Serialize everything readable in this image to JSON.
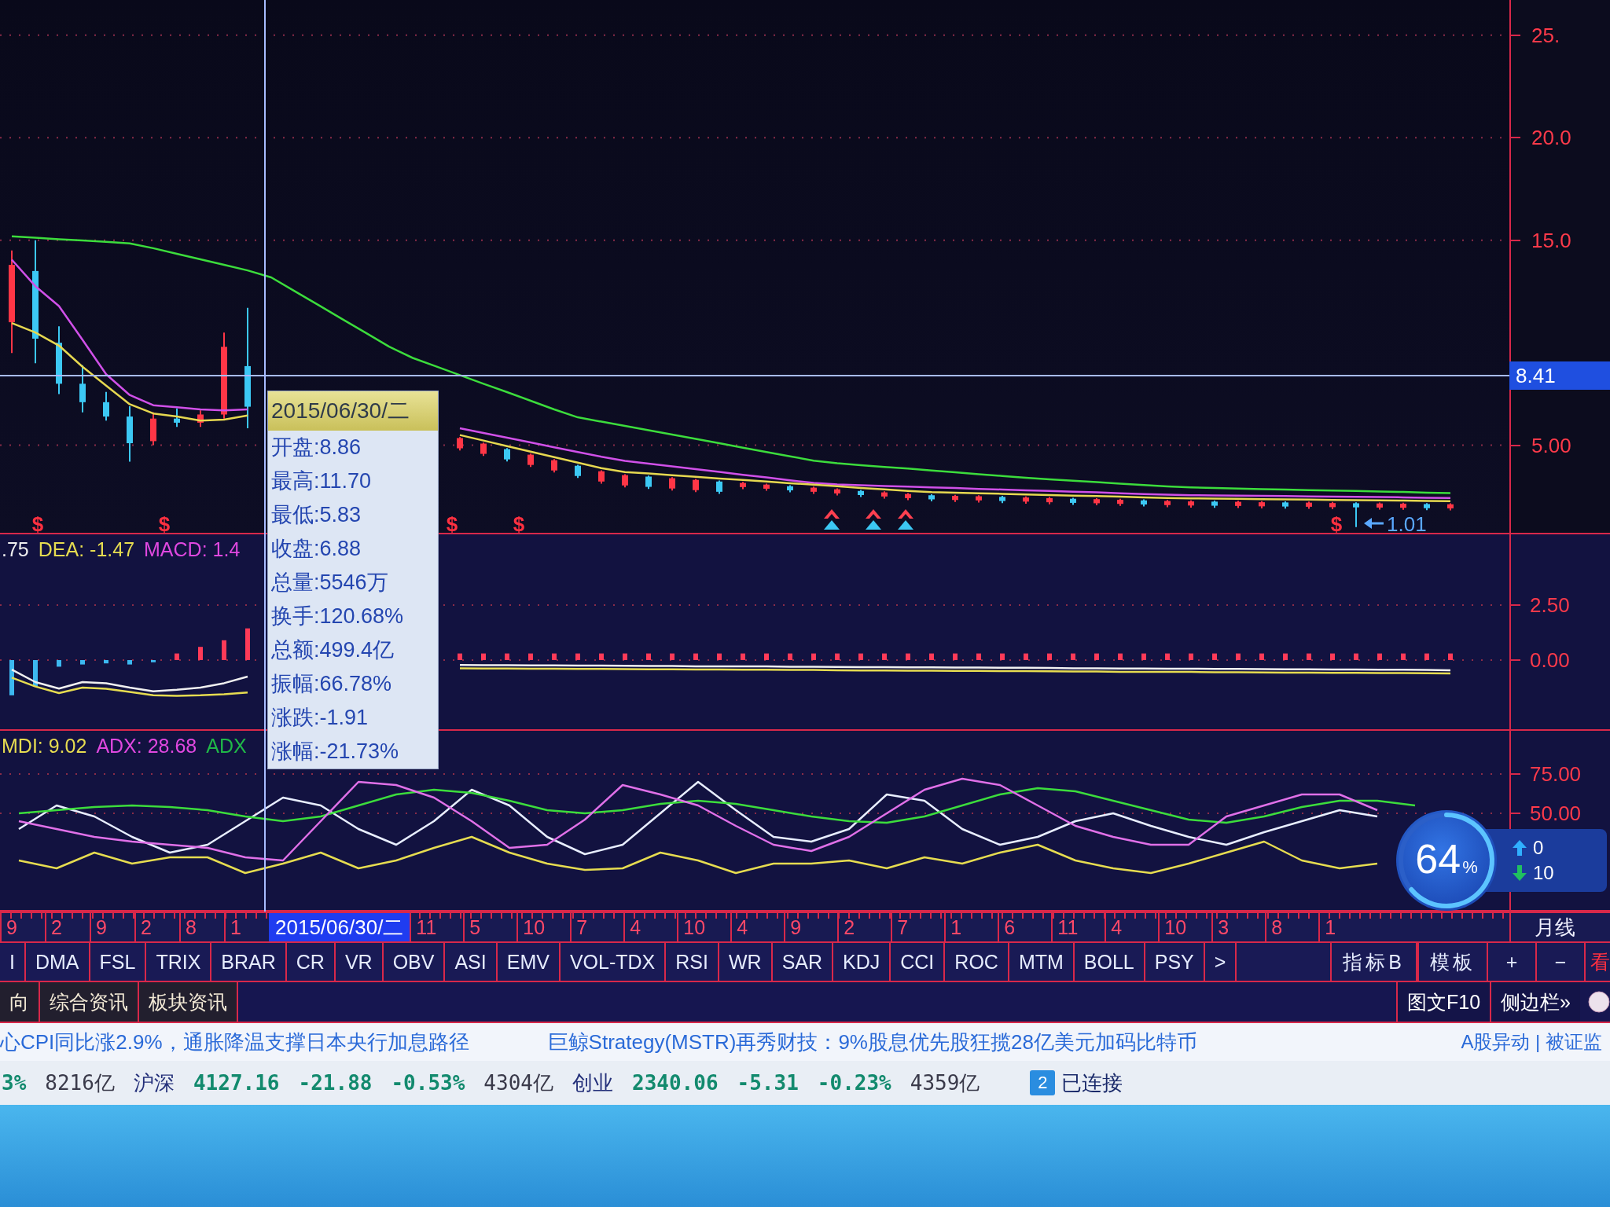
{
  "price_chart": {
    "chart_data": {
      "type": "candlestick",
      "grid": true,
      "categories": [
        null,
        null,
        null,
        null,
        null,
        null,
        null,
        null,
        null,
        null,
        null,
        null,
        null,
        null,
        null,
        null,
        null,
        null,
        null,
        null,
        null,
        null,
        null,
        null,
        null,
        null,
        null,
        null,
        null,
        null,
        null,
        null,
        null,
        null,
        null,
        null,
        null,
        null,
        null,
        null,
        null,
        null,
        null,
        null,
        null,
        null,
        null,
        null,
        null,
        null,
        null,
        null,
        null,
        null,
        null,
        null,
        null,
        null,
        null,
        null,
        null,
        null,
        null,
        null
      ],
      "ylim": [
        0.73,
        26.72
      ],
      "yticks": [
        {
          "value": 25,
          "label": "25."
        },
        {
          "value": 20,
          "label": "20.0"
        },
        {
          "value": 15,
          "label": "15.0"
        },
        {
          "value": 5,
          "label": "5.00"
        }
      ],
      "ohlc": [
        [
          11.0,
          14.5,
          9.5,
          13.8
        ],
        [
          13.5,
          15.0,
          9.0,
          10.2
        ],
        [
          10.0,
          10.8,
          7.5,
          8.0
        ],
        [
          8.0,
          8.9,
          6.6,
          7.1
        ],
        [
          7.1,
          7.6,
          6.2,
          6.4
        ],
        [
          6.4,
          6.9,
          4.2,
          5.1
        ],
        [
          5.2,
          6.6,
          5.0,
          6.3
        ],
        [
          6.3,
          6.8,
          5.9,
          6.1
        ],
        [
          6.1,
          6.7,
          5.9,
          6.5
        ],
        [
          6.5,
          10.5,
          6.3,
          9.8
        ],
        [
          8.86,
          11.7,
          5.83,
          6.88
        ],
        null,
        null,
        null,
        null,
        null,
        null,
        null,
        null,
        [
          4.85,
          5.4,
          4.75,
          5.35
        ],
        [
          4.58,
          5.13,
          4.48,
          5.08
        ],
        [
          4.81,
          4.86,
          4.21,
          4.31
        ],
        [
          4.04,
          4.59,
          3.94,
          4.54
        ],
        [
          3.77,
          4.32,
          3.67,
          4.27
        ],
        [
          4.0,
          4.05,
          3.4,
          3.5
        ],
        [
          3.23,
          3.78,
          3.13,
          3.73
        ],
        [
          3.04,
          3.59,
          2.94,
          3.54
        ],
        [
          3.47,
          3.52,
          2.87,
          2.97
        ],
        [
          2.89,
          3.44,
          2.79,
          3.39
        ],
        [
          2.81,
          3.36,
          2.71,
          3.31
        ],
        [
          3.23,
          3.28,
          2.63,
          2.73
        ],
        [
          2.96,
          3.21,
          2.86,
          3.16
        ],
        [
          2.88,
          3.13,
          2.78,
          3.08
        ],
        [
          3.0,
          3.05,
          2.7,
          2.8
        ],
        [
          2.73,
          2.98,
          2.63,
          2.93
        ],
        [
          2.65,
          2.9,
          2.55,
          2.85
        ],
        [
          2.77,
          2.82,
          2.47,
          2.57
        ],
        [
          2.5,
          2.75,
          2.4,
          2.7
        ],
        [
          2.42,
          2.67,
          2.32,
          2.62
        ],
        [
          2.56,
          2.61,
          2.26,
          2.36
        ],
        [
          2.33,
          2.58,
          2.23,
          2.53
        ],
        [
          2.31,
          2.56,
          2.21,
          2.51
        ],
        [
          2.48,
          2.53,
          2.18,
          2.28
        ],
        [
          2.25,
          2.5,
          2.15,
          2.45
        ],
        [
          2.22,
          2.47,
          2.12,
          2.42
        ],
        [
          2.39,
          2.44,
          2.09,
          2.19
        ],
        [
          2.17,
          2.42,
          2.07,
          2.37
        ],
        [
          2.14,
          2.39,
          2.04,
          2.34
        ],
        [
          2.31,
          2.36,
          2.01,
          2.11
        ],
        [
          2.08,
          2.33,
          1.98,
          2.28
        ],
        [
          2.06,
          2.31,
          1.96,
          2.26
        ],
        [
          2.25,
          2.3,
          1.95,
          2.05
        ],
        [
          2.04,
          2.29,
          1.94,
          2.24
        ],
        [
          2.02,
          2.27,
          1.92,
          2.22
        ],
        [
          2.21,
          2.26,
          1.91,
          2.01
        ],
        [
          2.0,
          2.25,
          1.9,
          2.2
        ],
        [
          1.98,
          2.23,
          1.88,
          2.18
        ],
        [
          2.17,
          2.22,
          1.01,
          1.97
        ],
        [
          1.96,
          2.21,
          1.86,
          2.16
        ],
        [
          1.95,
          2.2,
          1.85,
          2.15
        ],
        [
          2.13,
          2.18,
          1.83,
          1.93
        ],
        [
          1.92,
          2.17,
          1.82,
          2.12
        ],
        null,
        null
      ],
      "series": [
        {
          "type": "line",
          "color": "#3cdc3c",
          "values": [
            15.19,
            15.12,
            15.05,
            14.99,
            14.92,
            14.85,
            14.61,
            14.34,
            14.07,
            13.8,
            13.53,
            13.19,
            12.51,
            11.84,
            11.16,
            10.49,
            9.81,
            9.26,
            8.84,
            8.42,
            8.0,
            7.59,
            7.17,
            6.75,
            6.36,
            6.15,
            5.94,
            5.73,
            5.52,
            5.31,
            5.1,
            4.88,
            4.67,
            4.46,
            4.25,
            4.12,
            4.03,
            3.94,
            3.86,
            3.77,
            3.68,
            3.59,
            3.5,
            3.41,
            3.34,
            3.27,
            3.2,
            3.13,
            3.06,
            2.99,
            2.94,
            2.91,
            2.89,
            2.86,
            2.84,
            2.81,
            2.79,
            2.77,
            2.74,
            2.72,
            2.69,
            2.67,
            null,
            null
          ]
        },
        {
          "type": "line",
          "color": "#d050e8",
          "values": [
            14.05,
            12.76,
            11.79,
            10.14,
            8.46,
            7.45,
            6.95,
            6.85,
            6.75,
            6.7,
            6.75,
            null,
            null,
            null,
            null,
            null,
            null,
            null,
            null,
            5.83,
            5.6,
            5.37,
            5.14,
            4.9,
            4.67,
            4.44,
            4.24,
            4.1,
            3.97,
            3.83,
            3.7,
            3.56,
            3.43,
            3.29,
            3.16,
            3.09,
            3.05,
            3.01,
            2.98,
            2.94,
            2.91,
            2.87,
            2.84,
            2.8,
            2.77,
            2.73,
            2.7,
            2.66,
            2.62,
            2.59,
            2.56,
            2.55,
            2.54,
            2.53,
            2.52,
            2.5,
            2.49,
            2.48,
            2.47,
            2.46,
            2.44,
            2.43,
            null,
            null
          ]
        },
        {
          "type": "line",
          "color": "#e6d850",
          "values": [
            10.96,
            10.5,
            9.86,
            8.83,
            7.91,
            7.0,
            6.55,
            6.4,
            6.2,
            6.25,
            6.45,
            null,
            null,
            null,
            null,
            null,
            null,
            null,
            null,
            5.5,
            5.23,
            4.96,
            4.69,
            4.42,
            4.15,
            3.88,
            3.69,
            3.62,
            3.54,
            3.46,
            3.38,
            3.31,
            3.23,
            3.15,
            3.08,
            3.0,
            2.92,
            2.85,
            2.77,
            2.71,
            2.68,
            2.66,
            2.63,
            2.6,
            2.57,
            2.54,
            2.52,
            2.49,
            2.46,
            2.43,
            2.41,
            2.4,
            2.39,
            2.37,
            2.36,
            2.35,
            2.33,
            2.32,
            2.31,
            2.3,
            2.28,
            2.27,
            null,
            null
          ]
        }
      ]
    },
    "crosshair_price": "8.41",
    "low_price": "1.01",
    "signal_marks": [
      {
        "kind": "sell",
        "symbol": "$"
      },
      {
        "kind": "sell",
        "symbol": "$"
      },
      {
        "kind": "sell",
        "symbol": "$"
      },
      {
        "kind": "sell",
        "symbol": "$"
      },
      {
        "kind": "buy"
      },
      {
        "kind": "buy"
      },
      {
        "kind": "buy"
      },
      {
        "kind": "sell",
        "symbol": "$"
      }
    ]
  },
  "tooltip": {
    "date": "2015/06/30/二",
    "rows": [
      "开盘:8.86",
      "最高:11.70",
      "最低:5.83",
      "收盘:6.88",
      "总量:5546万",
      "换手:120.68%",
      "总额:499.4亿",
      "振幅:66.78%",
      "涨跌:-1.91",
      "涨幅:-21.73%"
    ]
  },
  "macd_panel": {
    "legend": [
      {
        "text": ".75",
        "color": "#f0f0f0"
      },
      {
        "text": "DEA: -1.47",
        "color": "#e6dc50"
      },
      {
        "text": "MACD: 1.4",
        "color": "#e048e0"
      }
    ],
    "chart_data": {
      "type": "line",
      "grid": true,
      "categories": [
        null,
        null,
        null,
        null,
        null,
        null,
        null,
        null,
        null,
        null,
        null,
        null,
        null,
        null,
        null,
        null,
        null,
        null,
        null,
        null,
        null,
        null,
        null,
        null,
        null,
        null,
        null,
        null,
        null,
        null,
        null,
        null,
        null,
        null,
        null,
        null,
        null,
        null,
        null,
        null,
        null,
        null,
        null,
        null,
        null,
        null,
        null,
        null,
        null,
        null,
        null,
        null,
        null,
        null,
        null,
        null,
        null,
        null,
        null,
        null,
        null,
        null,
        null,
        null
      ],
      "ylim": [
        -3.14,
        5.71
      ],
      "yticks": [
        {
          "value": 2.5,
          "label": "2.50"
        },
        {
          "value": 0,
          "label": "0.00"
        }
      ],
      "series": [
        {
          "type": "bar",
          "color": "#ff3a58",
          "values": [
            null,
            null,
            null,
            null,
            null,
            null,
            null,
            0.3,
            0.6,
            0.9,
            1.44,
            null,
            null,
            null,
            null,
            null,
            null,
            null,
            null,
            0.3,
            0.3,
            0.3,
            0.3,
            0.3,
            0.3,
            0.3,
            0.3,
            0.3,
            0.3,
            0.3,
            0.3,
            0.3,
            0.3,
            0.3,
            0.3,
            0.3,
            0.3,
            0.3,
            0.3,
            0.3,
            0.3,
            0.3,
            0.3,
            0.3,
            0.3,
            0.3,
            0.3,
            0.3,
            0.3,
            0.3,
            0.3,
            0.3,
            0.3,
            0.3,
            0.3,
            0.3,
            0.3,
            0.3,
            0.3,
            0.3,
            0.3,
            0.3,
            null,
            null
          ]
        },
        {
          "type": "bar",
          "color": "#3cb8f0",
          "values": [
            -1.6,
            -1.2,
            -0.3,
            -0.2,
            -0.15,
            -0.2,
            -0.1,
            null,
            null,
            null,
            null,
            null,
            null,
            null,
            null,
            null,
            null,
            null,
            null,
            null,
            null,
            null,
            null,
            null,
            null,
            null,
            null,
            null,
            null,
            null,
            null,
            null,
            null,
            null,
            null,
            null,
            null,
            null,
            null,
            null,
            null,
            null,
            null,
            null,
            null,
            null,
            null,
            null,
            null,
            null,
            null,
            null,
            null,
            null,
            null,
            null,
            null,
            null,
            null,
            null,
            null,
            null,
            null,
            null
          ]
        },
        {
          "color": "#f0f0f0",
          "values": [
            -0.43,
            -1.0,
            -1.29,
            -1.0,
            -1.05,
            -1.25,
            -1.42,
            -1.35,
            -1.25,
            -1.05,
            -0.75,
            null,
            null,
            null,
            null,
            null,
            null,
            null,
            null,
            -0.22,
            -0.23,
            -0.23,
            -0.24,
            -0.24,
            -0.25,
            -0.25,
            -0.26,
            -0.27,
            -0.27,
            -0.28,
            -0.28,
            -0.29,
            -0.29,
            -0.3,
            -0.3,
            -0.31,
            -0.32,
            -0.32,
            -0.33,
            -0.33,
            -0.34,
            -0.34,
            -0.35,
            -0.35,
            -0.36,
            -0.37,
            -0.37,
            -0.38,
            -0.38,
            -0.39,
            -0.39,
            -0.4,
            -0.4,
            -0.41,
            -0.42,
            -0.42,
            -0.43,
            -0.43,
            -0.44,
            -0.44,
            -0.45,
            -0.46,
            null,
            null
          ]
        },
        {
          "color": "#e6dc50",
          "values": [
            -0.8,
            -1.2,
            -1.5,
            -1.25,
            -1.3,
            -1.45,
            -1.6,
            -1.62,
            -1.6,
            -1.55,
            -1.47,
            null,
            null,
            null,
            null,
            null,
            null,
            null,
            null,
            -0.37,
            -0.38,
            -0.38,
            -0.39,
            -0.39,
            -0.4,
            -0.4,
            -0.41,
            -0.42,
            -0.42,
            -0.43,
            -0.43,
            -0.44,
            -0.44,
            -0.45,
            -0.45,
            -0.46,
            -0.47,
            -0.47,
            -0.48,
            -0.48,
            -0.49,
            -0.49,
            -0.5,
            -0.5,
            -0.51,
            -0.52,
            -0.52,
            -0.53,
            -0.53,
            -0.54,
            -0.54,
            -0.55,
            -0.55,
            -0.56,
            -0.57,
            -0.57,
            -0.58,
            -0.58,
            -0.59,
            -0.59,
            -0.6,
            -0.61,
            null,
            null
          ]
        }
      ]
    }
  },
  "dmi_panel": {
    "legend": [
      {
        "text": "MDI: 9.02",
        "color": "#e6dc50"
      },
      {
        "text": "ADX: 28.68",
        "color": "#e048e0"
      },
      {
        "text": "ADX",
        "color": "#20b848"
      }
    ],
    "chart_data": {
      "type": "line",
      "grid": true,
      "categories": [
        null,
        null,
        null,
        null,
        null,
        null,
        null,
        null,
        null,
        null,
        null,
        null,
        null,
        null,
        null,
        null,
        null,
        null,
        null,
        null,
        null,
        null,
        null,
        null,
        null,
        null,
        null,
        null,
        null,
        null,
        null,
        null,
        null,
        null,
        null,
        null,
        null,
        null,
        null,
        null
      ],
      "ylim": [
        -11.5,
        102.5
      ],
      "yticks": [
        {
          "value": 75,
          "label": "75.00"
        },
        {
          "value": 50,
          "label": "50.00"
        }
      ],
      "series": [
        {
          "color": "#e8eeff",
          "values": [
            40,
            55,
            48,
            35,
            25,
            30,
            45,
            60,
            55,
            40,
            30,
            45,
            65,
            55,
            35,
            24,
            30,
            50,
            70,
            52,
            35,
            32,
            40,
            62,
            58,
            40,
            30,
            35,
            45,
            50,
            42,
            35,
            30,
            38,
            45,
            52,
            48,
            null,
            null,
            null
          ]
        },
        {
          "color": "#3cdc3c",
          "values": [
            50,
            52,
            54,
            55,
            54,
            52,
            48,
            45,
            48,
            55,
            62,
            65,
            63,
            58,
            52,
            50,
            52,
            56,
            58,
            56,
            52,
            48,
            45,
            44,
            48,
            55,
            62,
            66,
            64,
            58,
            52,
            46,
            44,
            48,
            54,
            58,
            58,
            55,
            null,
            null
          ]
        },
        {
          "color": "#e070e8",
          "values": [
            45,
            40,
            35,
            32,
            30,
            28,
            22,
            20,
            45,
            70,
            68,
            60,
            45,
            28,
            30,
            46,
            68,
            62,
            55,
            42,
            30,
            26,
            35,
            50,
            65,
            72,
            68,
            55,
            42,
            35,
            30,
            30,
            48,
            55,
            62,
            62,
            52,
            null,
            null,
            null
          ]
        },
        {
          "color": "#e6dc50",
          "values": [
            20,
            15,
            25,
            18,
            22,
            22,
            12,
            18,
            25,
            15,
            20,
            28,
            35,
            25,
            18,
            14,
            15,
            25,
            20,
            12,
            18,
            18,
            20,
            15,
            22,
            18,
            25,
            30,
            20,
            15,
            12,
            18,
            25,
            32,
            20,
            15,
            18,
            null,
            null,
            null
          ]
        }
      ]
    }
  },
  "gauge": {
    "value": "64",
    "unit": "%",
    "upload": "0",
    "download": "10"
  },
  "date_axis": {
    "labels_before": [
      "9",
      "2",
      "9",
      "2",
      "8",
      "1"
    ],
    "cursor_date": "2015/06/30/二",
    "labels_after": [
      "11",
      "5",
      "10",
      "7",
      "4",
      "10",
      "4",
      "9",
      "2",
      "7",
      "1",
      "6",
      "11",
      "4",
      "10",
      "3",
      "8",
      "1"
    ],
    "period": "月线"
  },
  "indicator_tabs": [
    {
      "label": "I",
      "selected": false
    },
    {
      "label": "DMA",
      "selected": false
    },
    {
      "label": "FSL",
      "selected": false
    },
    {
      "label": "TRIX",
      "selected": false
    },
    {
      "label": "BRAR",
      "selected": false
    },
    {
      "label": "CR",
      "selected": false
    },
    {
      "label": "VR",
      "selected": false
    },
    {
      "label": "OBV",
      "selected": false
    },
    {
      "label": "ASI",
      "selected": false
    },
    {
      "label": "EMV",
      "selected": false
    },
    {
      "label": "VOL-TDX",
      "selected": false
    },
    {
      "label": "RSI",
      "selected": false
    },
    {
      "label": "WR",
      "selected": false
    },
    {
      "label": "SAR",
      "selected": false
    },
    {
      "label": "KDJ",
      "selected": false
    },
    {
      "label": "CCI",
      "selected": false
    },
    {
      "label": "ROC",
      "selected": false
    },
    {
      "label": "MTM",
      "selected": false
    },
    {
      "label": "BOLL",
      "selected": false
    },
    {
      "label": "PSY",
      "selected": false
    },
    {
      "label": ">",
      "selected": false
    }
  ],
  "toolbar_buttons": [
    "指标B",
    "模板"
  ],
  "zoom_buttons": [
    "+",
    "−"
  ],
  "side_tab": "看",
  "info_tabs": [
    {
      "label": "向",
      "selected": false
    },
    {
      "label": "综合资讯",
      "selected": false
    },
    {
      "label": "板块资讯",
      "selected": false
    }
  ],
  "panel_buttons": [
    "图文F10",
    "侧边栏»"
  ],
  "news_ticker": {
    "headlines": [
      "心CPI同比涨2.9%，通胀降温支撑日本央行加息路径",
      "巨鲸Strategy(MSTR)再秀财技：9%股息优先股狂揽28亿美元加码比特币"
    ],
    "links": "A股异动 | 被证监"
  },
  "status_bar": {
    "items": [
      {
        "kind": "change",
        "text": "3%"
      },
      {
        "kind": "amount",
        "text": "8216亿"
      },
      {
        "kind": "name",
        "text": "沪深"
      },
      {
        "kind": "change",
        "text": "4127.16"
      },
      {
        "kind": "change",
        "text": "-21.88"
      },
      {
        "kind": "change",
        "text": "-0.53%"
      },
      {
        "kind": "amount",
        "text": "4304亿"
      },
      {
        "kind": "name",
        "text": "创业"
      },
      {
        "kind": "change",
        "text": "2340.06"
      },
      {
        "kind": "change",
        "text": "-5.31"
      },
      {
        "kind": "change",
        "text": "-0.23%"
      },
      {
        "kind": "amount",
        "text": "4359亿"
      }
    ],
    "connection_count": "2",
    "connection_status": "已连接"
  }
}
